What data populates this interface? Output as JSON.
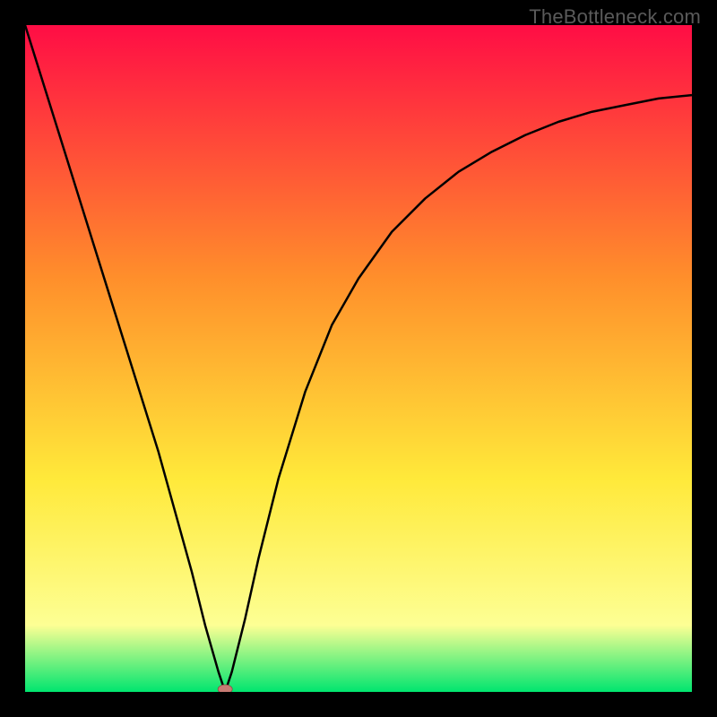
{
  "watermark": "TheBottleneck.com",
  "chart_data": {
    "type": "line",
    "title": "",
    "xlabel": "",
    "ylabel": "",
    "xlim": [
      0,
      100
    ],
    "ylim": [
      0,
      100
    ],
    "x": [
      0,
      5,
      10,
      15,
      20,
      25,
      27,
      29,
      30,
      31,
      33,
      35,
      38,
      42,
      46,
      50,
      55,
      60,
      65,
      70,
      75,
      80,
      85,
      90,
      95,
      100
    ],
    "values": [
      100,
      84,
      68,
      52,
      36,
      18,
      10,
      3,
      0,
      3,
      11,
      20,
      32,
      45,
      55,
      62,
      69,
      74,
      78,
      81,
      83.5,
      85.5,
      87,
      88,
      89,
      89.5
    ],
    "marker": {
      "x": 30,
      "y": 0
    },
    "gradient_background": {
      "top_color": "#ff0d45",
      "mid_upper_color": "#ff8f2b",
      "mid_lower_color": "#ffe93a",
      "near_bottom_color": "#fdff94",
      "bottom_color": "#00e56f"
    }
  }
}
